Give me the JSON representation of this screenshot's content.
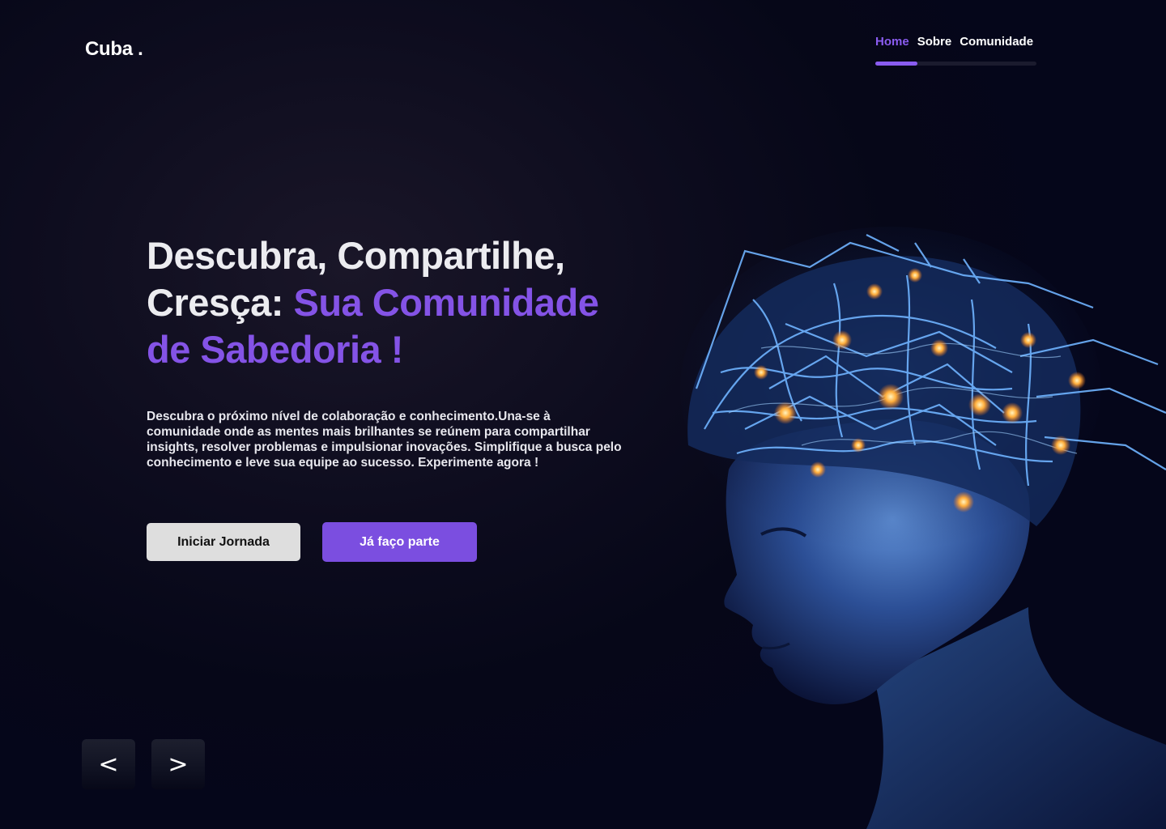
{
  "brand": {
    "logo": "Cuba ."
  },
  "nav": {
    "items": [
      {
        "label": "Home",
        "active": true
      },
      {
        "label": "Sobre",
        "active": false
      },
      {
        "label": "Comunidade",
        "active": false
      }
    ],
    "progress_fraction": 0.26,
    "active_color": "#8A5CF0"
  },
  "hero": {
    "title_line1": "Descubra, Compartilhe,",
    "title_line2_prefix": "Cresça: ",
    "title_accent_1": "Sua Comunidade",
    "title_accent_2": "de Sabedoria !",
    "description": "Descubra o próximo nível de colaboração e conhecimento.Una-se à comunidade onde as mentes mais brilhantes se reúnem para compartilhar insights, resolver problemas e impulsionar inovações. Simplifique a busca pelo conhecimento e leve sua equipe ao sucesso. Experimente agora !",
    "accent_color": "#8453E6"
  },
  "buttons": {
    "primary_label": "Iniciar Jornada",
    "secondary_label": "Já faço parte"
  },
  "carousel": {
    "prev_label": "<",
    "next_label": ">"
  },
  "image": {
    "icon": "neural-network-head-illustration"
  }
}
